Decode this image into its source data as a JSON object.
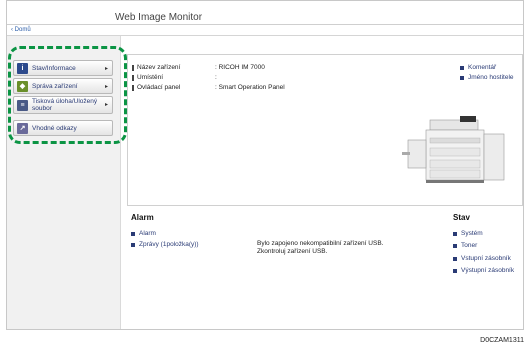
{
  "header": {
    "app_title": "Web Image Monitor"
  },
  "nav": {
    "home": "‹ Domů"
  },
  "menu": [
    {
      "label": "Stav/Informace",
      "icon": "info-icon",
      "color": "#2d4a8c"
    },
    {
      "label": "Správa zařízení",
      "icon": "device-management-icon",
      "color": "#6a8f2a"
    },
    {
      "label": "Tisková úloha/Uložený\nsoubor",
      "icon": "print-job-icon",
      "color": "#4a5a86"
    },
    {
      "label": "Vhodné odkazy",
      "icon": "link-icon",
      "color": "#6a6a9a"
    }
  ],
  "device_info": [
    {
      "key": "Název zařízení",
      "value": ": RICOH IM 7000"
    },
    {
      "key": "Umístění",
      "value": ":"
    },
    {
      "key": "Ovládací panel",
      "value": ": Smart Operation Panel"
    }
  ],
  "right_links": [
    "Komentář",
    "Jméno hostitele"
  ],
  "alarm": {
    "title": "Alarm",
    "items": [
      "Alarm",
      "Zprávy (1položka(y))"
    ],
    "message_line1": "Bylo zapojeno nekompatibilní zařízení USB.",
    "message_line2": "Zkontroluj zařízení USB."
  },
  "status": {
    "title": "Stav",
    "items": [
      "Systém",
      "Toner",
      "Vstupní zásobník",
      "Výstupní zásobník"
    ]
  },
  "doc_id": "D0CZAM1311",
  "colors": {
    "highlight": "#0b9444",
    "link": "#2a3b75"
  }
}
